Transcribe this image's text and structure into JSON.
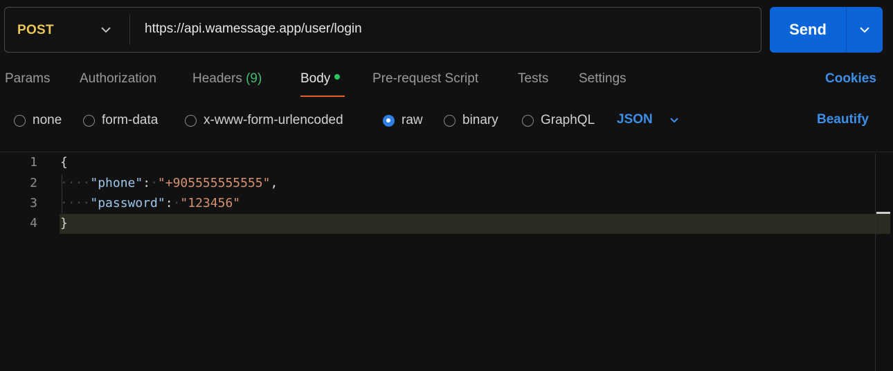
{
  "request": {
    "method": "POST",
    "url": "https://api.wamessage.app/user/login",
    "send_label": "Send"
  },
  "tabs": [
    {
      "label": "Params"
    },
    {
      "label": "Authorization"
    },
    {
      "label": "Headers",
      "count": "(9)"
    },
    {
      "label": "Body",
      "active": true
    },
    {
      "label": "Pre-request Script"
    },
    {
      "label": "Tests"
    },
    {
      "label": "Settings"
    }
  ],
  "cookies_label": "Cookies",
  "body_types": [
    {
      "label": "none",
      "checked": false
    },
    {
      "label": "form-data",
      "checked": false
    },
    {
      "label": "x-www-form-urlencoded",
      "checked": false
    },
    {
      "label": "raw",
      "checked": true
    },
    {
      "label": "binary",
      "checked": false
    },
    {
      "label": "GraphQL",
      "checked": false
    }
  ],
  "format": "JSON",
  "beautify_label": "Beautify",
  "editor": {
    "line_numbers": [
      "1",
      "2",
      "3",
      "4"
    ],
    "open_brace": "{",
    "close_brace": "}",
    "fields": [
      {
        "key": "\"phone\"",
        "value": "\"+905555555555\"",
        "trailing": ","
      },
      {
        "key": "\"password\"",
        "value": "\"123456\"",
        "trailing": ""
      }
    ]
  },
  "colors": {
    "method": "#e9c65a",
    "accent": "#3d8fe8",
    "send_button": "#0b64d8",
    "active_tab_underline": "#e6602f",
    "body_dot": "#2ec25c",
    "headers_count": "#3fbf6f"
  }
}
